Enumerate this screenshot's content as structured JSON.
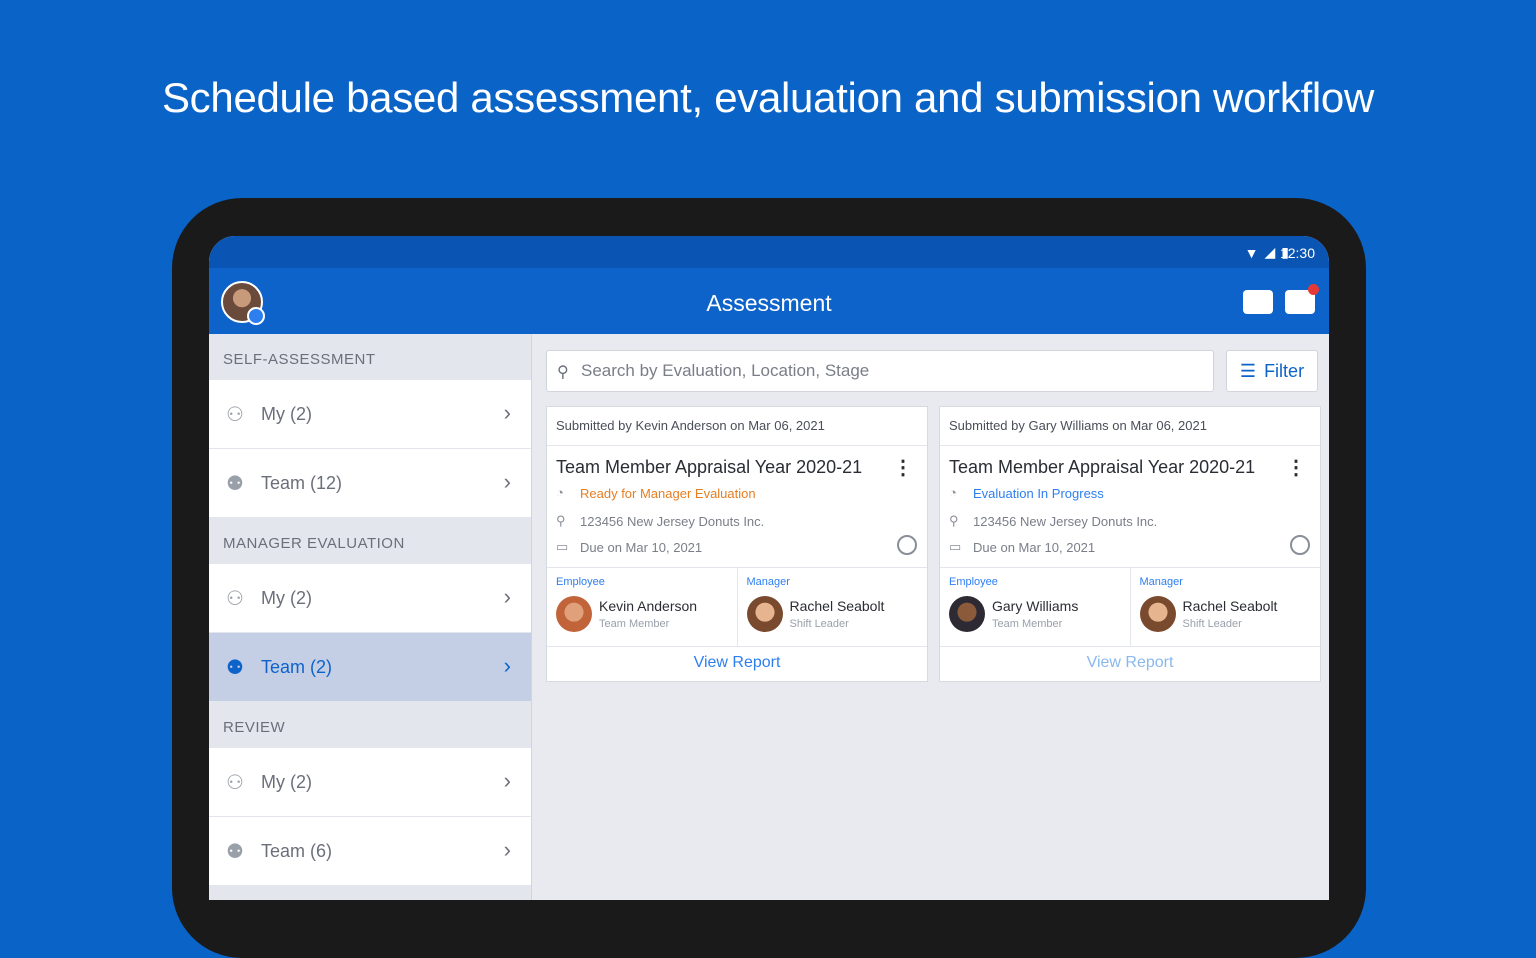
{
  "headline": "Schedule based assessment, evaluation and submission workflow",
  "status_bar": {
    "time": "12:30"
  },
  "appbar": {
    "title": "Assessment"
  },
  "sidebar": {
    "sections": [
      {
        "heading": "SELF-ASSESSMENT",
        "items": [
          {
            "label": "My (2)"
          },
          {
            "label": "Team (12)"
          }
        ]
      },
      {
        "heading": "MANAGER EVALUATION",
        "items": [
          {
            "label": "My (2)"
          },
          {
            "label": "Team (2)",
            "active": true
          }
        ]
      },
      {
        "heading": "REVIEW",
        "items": [
          {
            "label": "My (2)"
          },
          {
            "label": "Team (6)"
          }
        ]
      }
    ]
  },
  "search": {
    "placeholder": "Search by Evaluation, Location, Stage"
  },
  "filter": {
    "label": "Filter"
  },
  "cards": [
    {
      "submitted": "Submitted by Kevin Anderson on Mar 06, 2021",
      "title": "Team Member Appraisal Year 2020-21",
      "status": "Ready for Manager Evaluation",
      "location": "123456 New Jersey Donuts Inc.",
      "due": "Due on Mar 10, 2021",
      "employee": {
        "role_label": "Employee",
        "name": "Kevin Anderson",
        "role": "Team Member"
      },
      "manager": {
        "role_label": "Manager",
        "name": "Rachel Seabolt",
        "role": "Shift Leader"
      },
      "action": "View Report"
    },
    {
      "submitted": "Submitted by Gary Williams on Mar 06, 2021",
      "title": "Team Member Appraisal Year 2020-21",
      "status": "Evaluation In Progress",
      "location": "123456 New Jersey Donuts Inc.",
      "due": "Due on Mar 10, 2021",
      "employee": {
        "role_label": "Employee",
        "name": "Gary Williams",
        "role": "Team Member"
      },
      "manager": {
        "role_label": "Manager",
        "name": "Rachel Seabolt",
        "role": "Shift Leader"
      },
      "action": "View Report"
    }
  ],
  "colors": {
    "brand_blue": "#0d63c9",
    "background_blue": "#0a63c7",
    "status_orange": "#e67e22",
    "link_blue": "#2d7ff0",
    "notification_red": "#e53935"
  }
}
